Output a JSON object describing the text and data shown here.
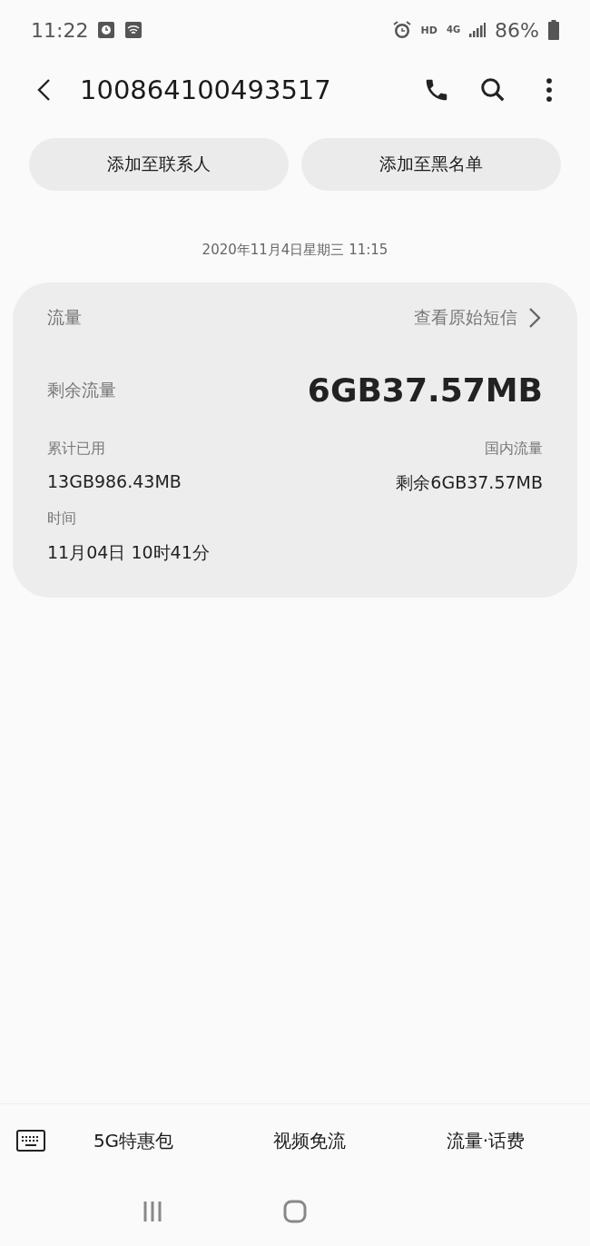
{
  "status_bar": {
    "time": "11:22",
    "network_badge": "HD",
    "network_type": "4G",
    "battery": "86%"
  },
  "header": {
    "title": "100864100493517"
  },
  "actions": [
    "添加至联系人",
    "添加至黑名单"
  ],
  "date": "2020年11月4日星期三 11:15",
  "card": {
    "category": "流量",
    "link": "查看原始短信",
    "main_label": "剩余流量",
    "main_value": "6GB37.57MB",
    "fields": [
      {
        "label": "累计已用",
        "value": "13GB986.43MB",
        "kind": "start"
      },
      {
        "label": "国内流量",
        "value": "剩余6GB37.57MB",
        "kind": "end"
      },
      {
        "label": "时间",
        "value": "11月04日 10时41分",
        "kind": "start"
      }
    ]
  },
  "menu": [
    "5G特惠包",
    "视频免流",
    "流量·话费"
  ]
}
